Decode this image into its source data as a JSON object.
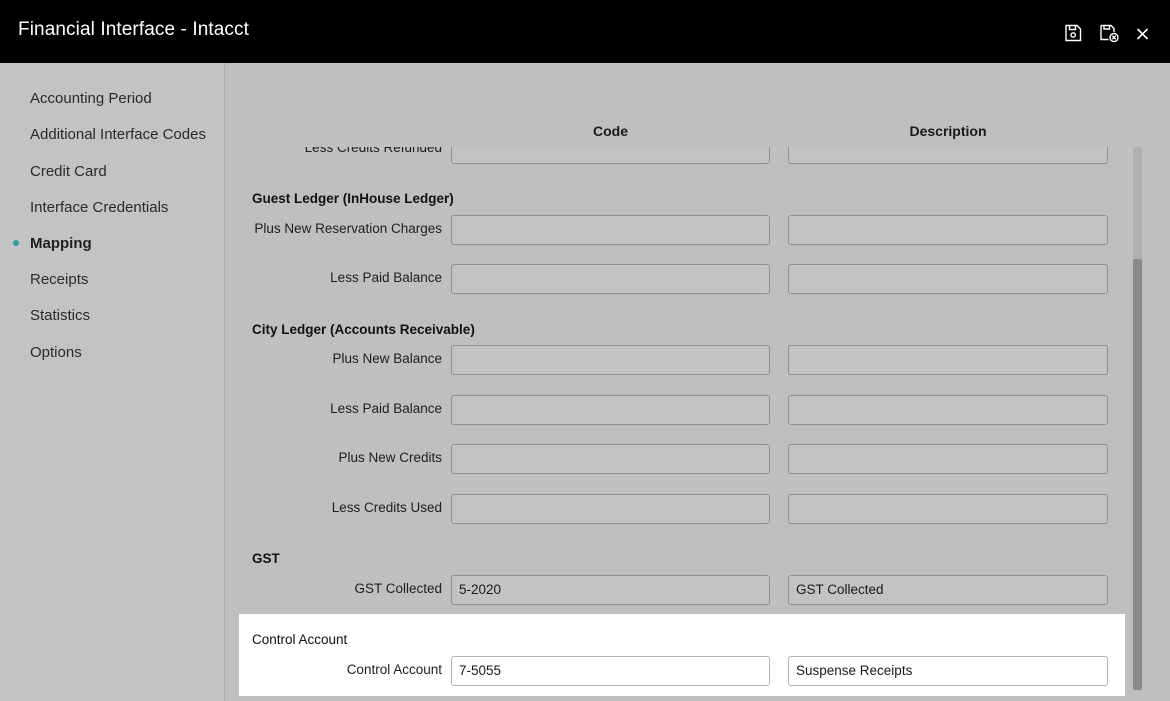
{
  "window": {
    "title": "Financial Interface - Intacct",
    "save_icon": "save-icon",
    "save_close_icon": "save-and-close-icon",
    "close_icon": "close-icon"
  },
  "sidebar": {
    "items": [
      {
        "label": "Accounting Period"
      },
      {
        "label": "Additional Interface Codes"
      },
      {
        "label": "Credit Card"
      },
      {
        "label": "Interface Credentials"
      },
      {
        "label": "Mapping",
        "active": true
      },
      {
        "label": "Receipts"
      },
      {
        "label": "Statistics"
      },
      {
        "label": "Options"
      }
    ],
    "active_color": "#2a9d97"
  },
  "columns": {
    "code": "Code",
    "description": "Description"
  },
  "partial_row": {
    "label": "Less Credits Refunded",
    "code": "",
    "description": ""
  },
  "sections": [
    {
      "title": "Guest Ledger (InHouse Ledger)",
      "rows": [
        {
          "label": "Plus New Reservation Charges",
          "code": "",
          "description": ""
        },
        {
          "label": "Less Paid Balance",
          "code": "",
          "description": ""
        }
      ]
    },
    {
      "title": "City Ledger (Accounts Receivable)",
      "rows": [
        {
          "label": "Plus New Balance",
          "code": "",
          "description": ""
        },
        {
          "label": "Less Paid Balance",
          "code": "",
          "description": ""
        },
        {
          "label": "Plus New Credits",
          "code": "",
          "description": ""
        },
        {
          "label": "Less Credits Used",
          "code": "",
          "description": ""
        }
      ]
    },
    {
      "title": "GST",
      "rows": [
        {
          "label": "GST Collected",
          "code": "5-2020",
          "description": "GST Collected"
        }
      ]
    },
    {
      "title": "Control Account",
      "highlighted": true,
      "rows": [
        {
          "label": "Control Account",
          "code": "7-5055",
          "description": "Suspense Receipts"
        }
      ]
    }
  ]
}
